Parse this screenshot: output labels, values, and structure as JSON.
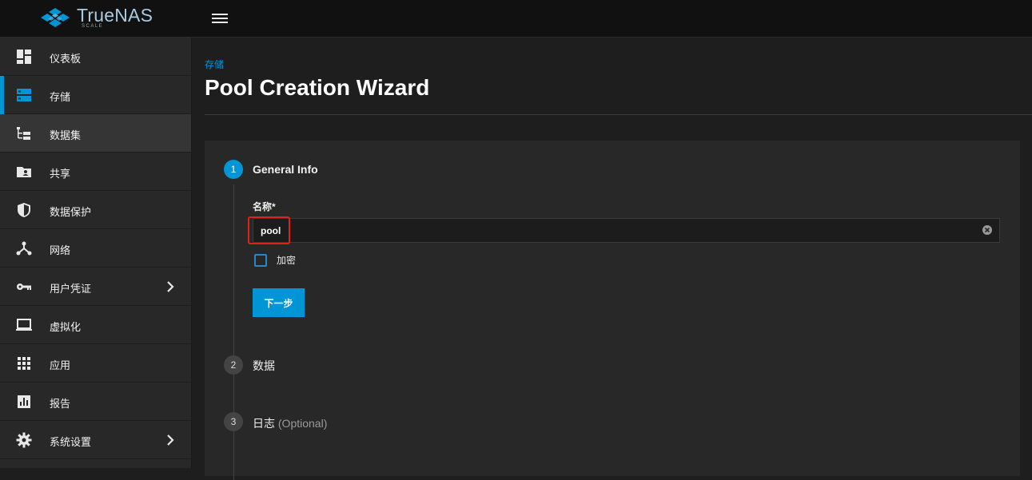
{
  "app": {
    "brand": "TrueNAS",
    "brand_sub": "SCALE"
  },
  "sidebar": {
    "items": [
      {
        "label": "仪表板",
        "icon": "dashboard-icon"
      },
      {
        "label": "存储",
        "icon": "storage-icon",
        "active": true
      },
      {
        "label": "数据集",
        "icon": "datasets-icon",
        "hover": true
      },
      {
        "label": "共享",
        "icon": "shares-icon"
      },
      {
        "label": "数据保护",
        "icon": "shield-icon"
      },
      {
        "label": "网络",
        "icon": "network-icon"
      },
      {
        "label": "用户凭证",
        "icon": "key-icon",
        "expandable": true
      },
      {
        "label": "虚拟化",
        "icon": "laptop-icon"
      },
      {
        "label": "应用",
        "icon": "apps-grid-icon"
      },
      {
        "label": "报告",
        "icon": "bar-chart-icon"
      },
      {
        "label": "系统设置",
        "icon": "gear-icon",
        "expandable": true
      }
    ]
  },
  "main": {
    "breadcrumb": "存储",
    "title": "Pool Creation Wizard",
    "steps": [
      {
        "number": "1",
        "title": "General Info"
      },
      {
        "number": "2",
        "title": "数据"
      },
      {
        "number": "3",
        "title": "日志",
        "optional": "(Optional)"
      }
    ],
    "form": {
      "name_label": "名称*",
      "name_value": "pool",
      "encrypt_label": "加密",
      "next_label": "下一步"
    }
  },
  "colors": {
    "accent": "#0095d5",
    "highlight": "#e0201a"
  }
}
